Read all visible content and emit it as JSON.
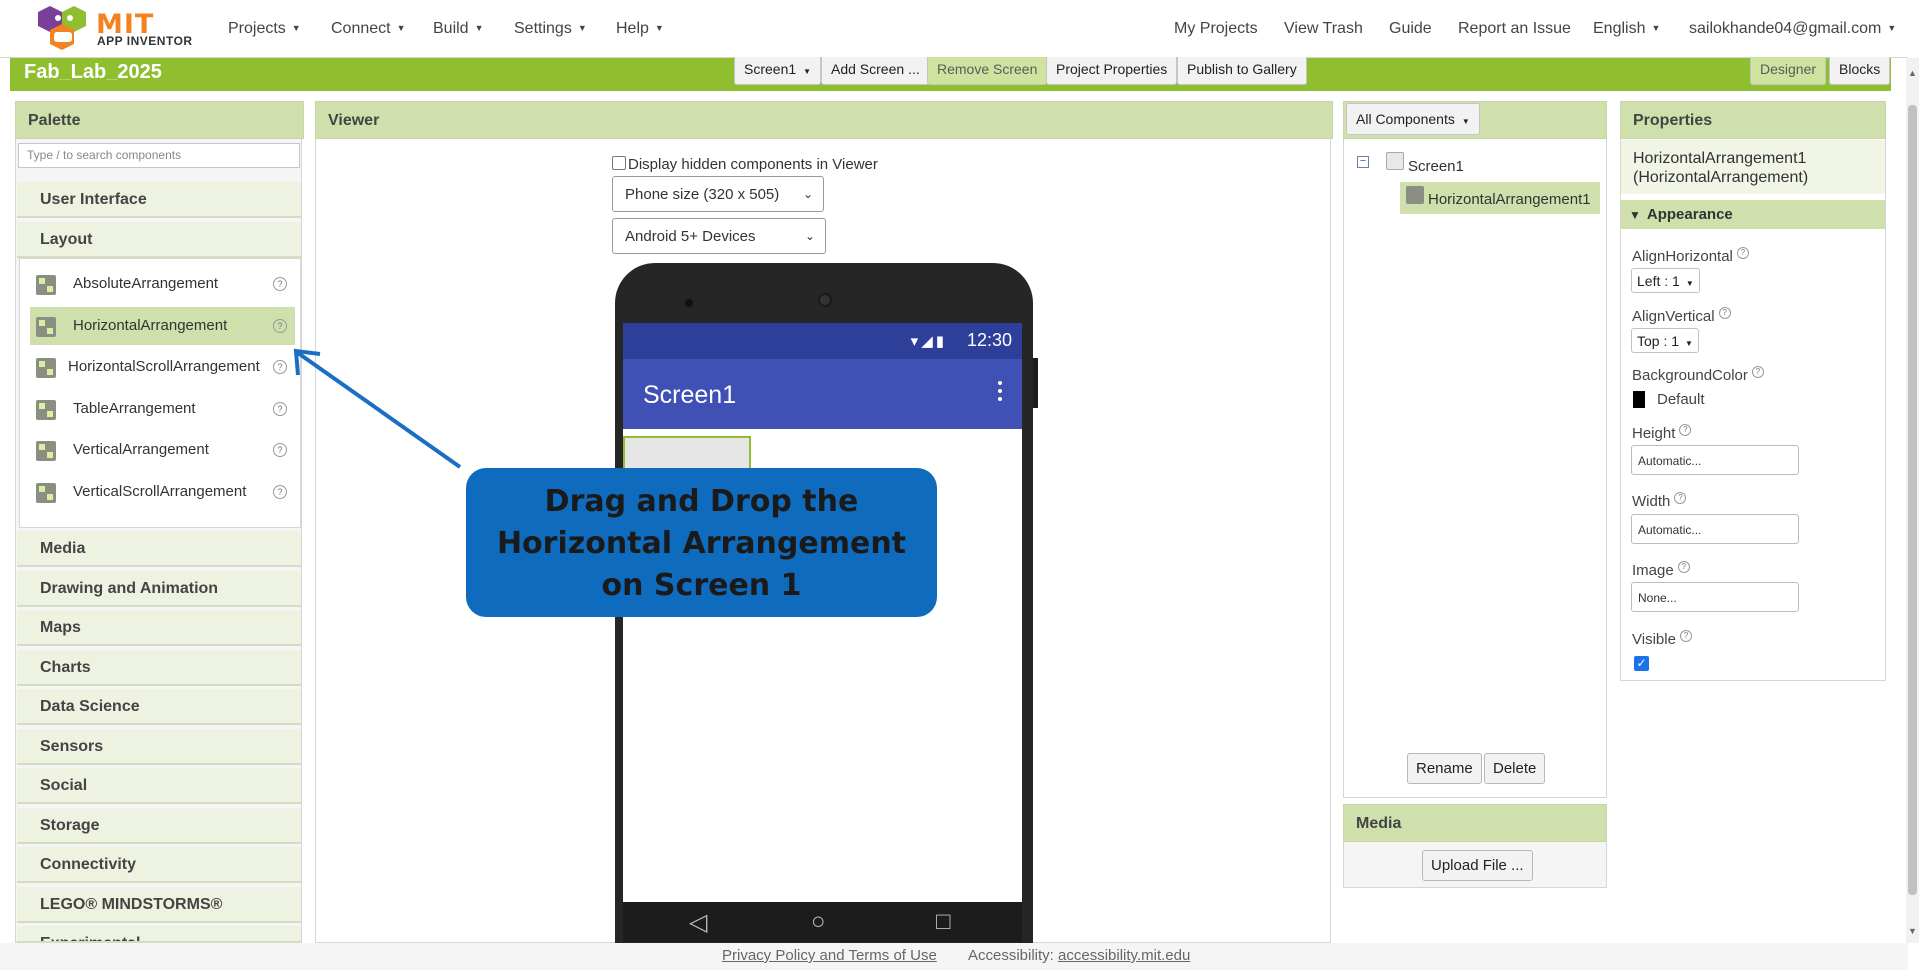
{
  "header": {
    "logo_text": "MIT",
    "logo_subtext": "APP INVENTOR",
    "menus": [
      {
        "label": "Projects"
      },
      {
        "label": "Connect"
      },
      {
        "label": "Build"
      },
      {
        "label": "Settings"
      },
      {
        "label": "Help"
      }
    ],
    "right_links": [
      "My Projects",
      "View Trash",
      "Guide",
      "Report an Issue"
    ],
    "language": "English",
    "account": "sailokhande04@gmail.com"
  },
  "project": {
    "name": "Fab_Lab_2025",
    "screen_select": "Screen1",
    "add_screen": "Add Screen ...",
    "remove_screen": "Remove Screen",
    "properties": "Project Properties",
    "publish": "Publish to Gallery",
    "designer": "Designer",
    "blocks": "Blocks"
  },
  "palette": {
    "title": "Palette",
    "search_placeholder": "Type / to search components",
    "categories_top": [
      "User Interface",
      "Layout"
    ],
    "layout_items": [
      {
        "label": "AbsoluteArrangement",
        "help": "?"
      },
      {
        "label": "HorizontalArrangement",
        "help": "?"
      },
      {
        "label": "HorizontalScrollArrangement",
        "help": "?"
      },
      {
        "label": "TableArrangement",
        "help": "?"
      },
      {
        "label": "VerticalArrangement",
        "help": "?"
      },
      {
        "label": "VerticalScrollArrangement",
        "help": "?"
      }
    ],
    "categories_bottom": [
      "Media",
      "Drawing and Animation",
      "Maps",
      "Charts",
      "Data Science",
      "Sensors",
      "Social",
      "Storage",
      "Connectivity",
      "LEGO® MINDSTORMS®",
      "Experimental"
    ]
  },
  "viewer": {
    "title": "Viewer",
    "hidden_label": "Display hidden components in Viewer",
    "size_select": "Phone size (320 x 505)",
    "device_select": "Android 5+ Devices",
    "status_time": "12:30",
    "app_title": "Screen1"
  },
  "callout": {
    "line1": "Drag and Drop the",
    "line2": "Horizontal Arrangement",
    "line3": "on Screen 1"
  },
  "components": {
    "filter": "All Components",
    "tree": [
      {
        "label": "Screen1"
      },
      {
        "label": "HorizontalArrangement1"
      }
    ],
    "rename": "Rename",
    "delete": "Delete"
  },
  "media": {
    "title": "Media",
    "upload": "Upload File ..."
  },
  "properties": {
    "title": "Properties",
    "component_name": "HorizontalArrangement1",
    "component_type": "(HorizontalArrangement)",
    "section": "Appearance",
    "align_horizontal_label": "AlignHorizontal",
    "align_horizontal_value": "Left : 1",
    "align_vertical_label": "AlignVertical",
    "align_vertical_value": "Top : 1",
    "background_color_label": "BackgroundColor",
    "background_color_value": "Default",
    "height_label": "Height",
    "height_value": "Automatic...",
    "width_label": "Width",
    "width_value": "Automatic...",
    "image_label": "Image",
    "image_value": "None...",
    "visible_label": "Visible",
    "visible_checked": true
  },
  "footer": {
    "privacy": "Privacy Policy and Terms of Use",
    "accessibility_label": "Accessibility:",
    "accessibility_link": "accessibility.mit.edu"
  },
  "colors": {
    "accent_green": "#8fbf2e",
    "panel_header": "#cfe0ad",
    "app_bar": "#3f51b5",
    "callout_blue": "#0f6bbd"
  }
}
